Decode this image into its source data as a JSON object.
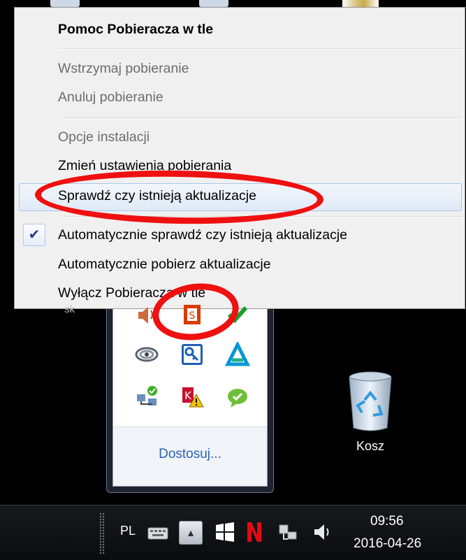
{
  "menu": {
    "title": "Pomoc Pobieracza w tle",
    "items": [
      {
        "label": "Wstrzymaj pobieranie",
        "state": "disabled"
      },
      {
        "label": "Anuluj pobieranie",
        "state": "disabled"
      },
      {
        "label": "Opcje instalacji",
        "state": "disabled"
      },
      {
        "label": "Zmień ustawienia pobierania",
        "state": "enabled"
      },
      {
        "label": "Sprawdź czy istnieją aktualizacje",
        "state": "highlighted"
      },
      {
        "label": "Automatycznie sprawdź czy istnieją aktualizacje",
        "state": "checked"
      },
      {
        "label": "Automatycznie pobierz aktualizacje",
        "state": "enabled"
      },
      {
        "label": "Wyłącz Pobieracza w tle",
        "state": "enabled"
      }
    ]
  },
  "tray": {
    "customize_label": "Dostosuj...",
    "partial_label": "sk",
    "icons": [
      "speaker-warning-icon",
      "office-icon",
      "green-check-icon",
      "cloud-app-icon",
      "key-icon",
      "autodesk-icon",
      "network-check-icon",
      "kaspersky-warning-icon",
      "green-chat-icon"
    ]
  },
  "desktop": {
    "recycle_bin_label": "Kosz"
  },
  "taskbar": {
    "language": "PL",
    "time": "09:56",
    "date": "2016-04-26"
  },
  "colors": {
    "annotation_red": "#ef1010",
    "link_blue": "#2a62b7",
    "check_blue": "#1e3f8f"
  }
}
